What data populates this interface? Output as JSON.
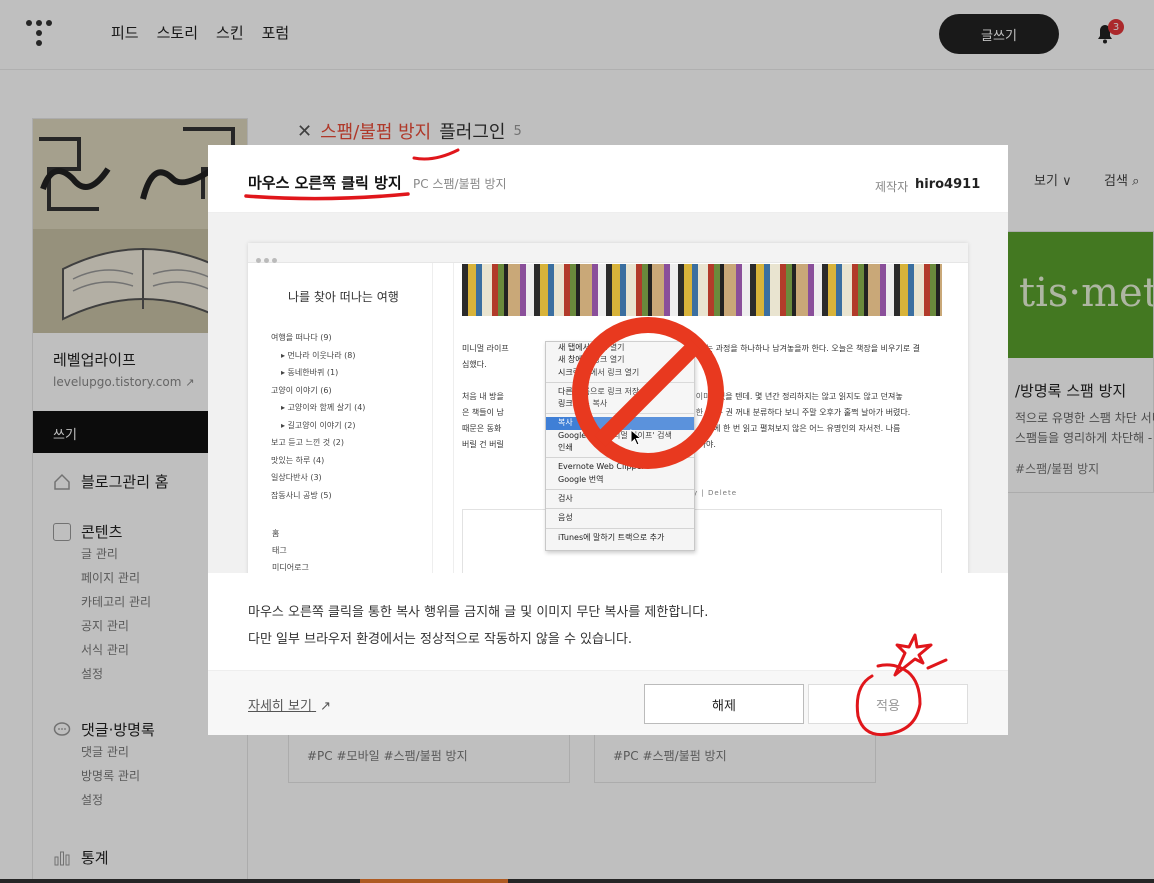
{
  "topnav": {
    "items": [
      "피드",
      "스토리",
      "스킨",
      "포럼"
    ],
    "write_label": "글쓰기",
    "notification_count": "3"
  },
  "sidebar": {
    "blog_name": "레벨업라이프",
    "blog_url": "levelupgo.tistory.com",
    "write_label": "쓰기",
    "groups": [
      {
        "label": "블로그관리 홈",
        "icon": "home-icon",
        "subs": []
      },
      {
        "label": "콘텐츠",
        "icon": "document-icon",
        "subs": [
          "글 관리",
          "페이지 관리",
          "카테고리 관리",
          "공지 관리",
          "서식 관리",
          "설정"
        ]
      },
      {
        "label": "댓글·방명록",
        "icon": "comment-icon",
        "subs": [
          "댓글 관리",
          "방명록 관리",
          "설정"
        ]
      },
      {
        "label": "통계",
        "icon": "chart-icon",
        "subs": []
      }
    ]
  },
  "page": {
    "close_icon": "close-icon",
    "title_prefix": "스팸/불펌 방지",
    "title_suffix": "플러그인",
    "title_count": "5",
    "filter_label": "보기",
    "search_label": "검색",
    "right_card": {
      "image_text": "tis·met",
      "title": "/방명록 스팸 방지",
      "desc_lines": [
        "적으로 유명한 스팸 차단 서비",
        "스팸들을 영리하게 차단해 -"
      ],
      "tag": "스팸/불펌 방지"
    },
    "bottom_cards": [
      {
        "tags": "#PC   #모바일   #스팸/불펌 방지"
      },
      {
        "tags": "#PC   #스팸/불펌 방지"
      }
    ]
  },
  "modal": {
    "title": "마우스 오른쪽 클릭 방지",
    "category": "PC 스팸/불펌 방지",
    "author_label": "제작자",
    "author": "hiro4911",
    "description": [
      "마우스 오른쪽 클릭을 통한 복사 행위를 금지해 글 및 이미지 무단 복사를 제한합니다.",
      "다만 일부 브라우저 환경에서는 정상적으로 작동하지 않을 수 있습니다."
    ],
    "more_link": "자세히 보기",
    "btn_disable": "해제",
    "btn_apply": "적용"
  },
  "preview": {
    "blog_title": "나를 찾아 떠나는 여행",
    "categories": [
      {
        "label": "여행을 떠나다 (9)",
        "sub": false
      },
      {
        "label": "먼나라 이웃나라 (8)",
        "sub": true
      },
      {
        "label": "동네한바퀴 (1)",
        "sub": true
      },
      {
        "label": "고양이 이야기 (6)",
        "sub": false
      },
      {
        "label": "고양이와 함께 살기 (4)",
        "sub": true
      },
      {
        "label": "길고양이 이야기 (2)",
        "sub": true
      },
      {
        "label": "보고 듣고 느낀 것 (2)",
        "sub": false
      },
      {
        "label": "맛있는 하루 (4)",
        "sub": false
      },
      {
        "label": "일상다반사 (3)",
        "sub": false
      },
      {
        "label": "잡동사니 공방 (5)",
        "sub": false
      }
    ],
    "footer_links": [
      "홈",
      "태그",
      "미디어로그"
    ],
    "body_lines": [
      "미니멀 라이프                                                              고자 청소하는 과정을 하나하나 남겨놓을까 한다. 오늘은 책장을 비우기로 결",
      "심했다.",
      "",
      "처음 내 방을                                                 인 오          서재의 이미지였을 텐데. 몇 년간 정리하지는 않고 읽지도 않고 던져놓",
      "은 책들이 남                                                 는 기         로 책을 한 권 두 권 꺼내 분류하다 보니 주말 오후가 훌쩍 날아가 버렸다.",
      "때문은 동화                                                   정          후감 숙제 때문에 한 번 읽고 펼쳐보지 않은 어느 유명인의 자서전. 나름",
      "버릴 건 버릴                                                               나 많음 좋아야."
    ],
    "modify_label": "Modify  |  Delete",
    "context_menu": [
      {
        "label": "새 탭에서 링크 열기",
        "type": "item"
      },
      {
        "label": "새 창에서 링크 열기",
        "type": "item"
      },
      {
        "label": "시크릿 창에서 링크 열기",
        "type": "item"
      },
      {
        "type": "sep"
      },
      {
        "label": "다른 이름으로 링크 저장",
        "type": "item"
      },
      {
        "label": "링크 주소 복사",
        "type": "item"
      },
      {
        "type": "sep"
      },
      {
        "label": "복사",
        "type": "highlight"
      },
      {
        "label": "Google에서 '미니멀 라이프' 검색",
        "type": "item"
      },
      {
        "label": "인쇄",
        "type": "item"
      },
      {
        "type": "sep"
      },
      {
        "label": "Evernote Web Clipper",
        "type": "item"
      },
      {
        "label": "Google 번역",
        "type": "item"
      },
      {
        "type": "sep"
      },
      {
        "label": "검사",
        "type": "item"
      },
      {
        "type": "sep"
      },
      {
        "label": "음성",
        "type": "item"
      },
      {
        "type": "sep"
      },
      {
        "label": "iTunes에 말하기 트랙으로 추가",
        "type": "item"
      }
    ]
  },
  "colors": {
    "accent_red": "#ea4c39",
    "annotation_red": "#e0161b",
    "dark_button": "#222222",
    "highlight_blue": "#3f7fd6"
  }
}
